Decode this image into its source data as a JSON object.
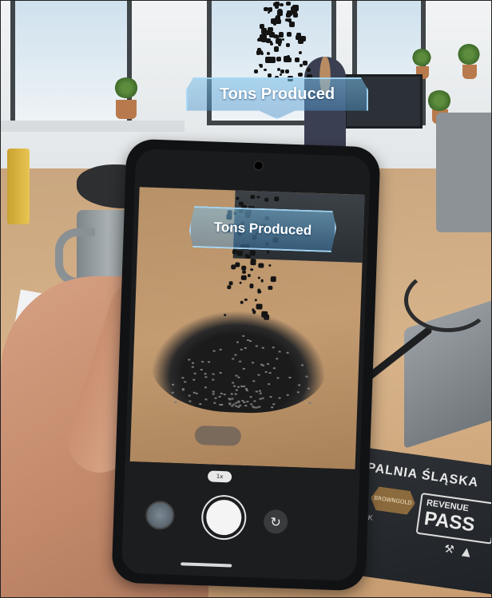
{
  "scene": {
    "ar_overlay_label": "Tons Produced",
    "phone_ar_label": "Tons Produced"
  },
  "card": {
    "title": "KOPALNIA ŚLĄSKA",
    "badge_text": "BROWNGOLD",
    "revenue_label": "REVENUE",
    "pass_label": "PASS",
    "small_text": "MAIGRUK\n2023"
  },
  "camera_app": {
    "zoom_chip": "1x",
    "switch_icon": "↻"
  },
  "colors": {
    "ar_label_fill": "#78bee6",
    "ar_label_border": "#aadcfa",
    "card_bg": "#2e3236",
    "coal": "#141414"
  },
  "icons": [
    "camera-switch-icon",
    "gallery-thumbnail-icon",
    "shutter-button-icon",
    "tools-icon"
  ]
}
